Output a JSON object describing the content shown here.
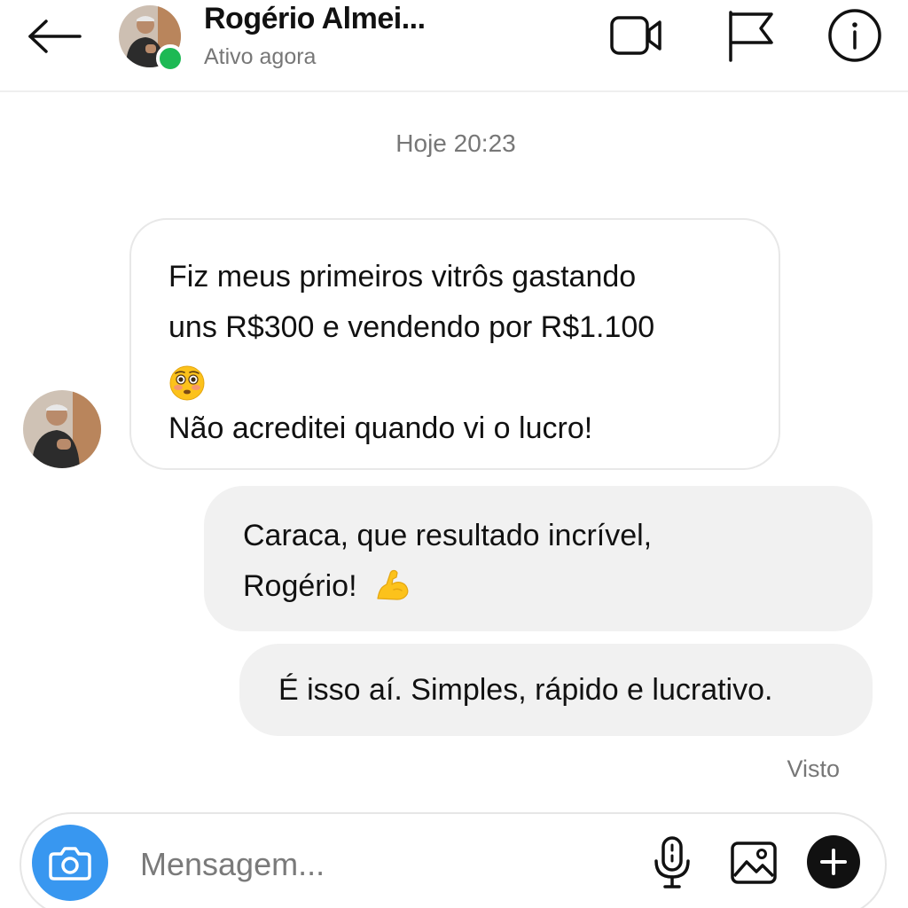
{
  "header": {
    "contact_name": "Rogério Almei...",
    "status": "Ativo agora",
    "icons": {
      "back": "arrow-left-icon",
      "video": "video-camera-icon",
      "report": "flag-icon",
      "info": "info-icon"
    },
    "online_color": "#1db954"
  },
  "chat": {
    "timestamp": "Hoje 20:23",
    "incoming": {
      "lines": [
        "Fiz meus primeiros vitrôs gastando",
        "uns R$300 e vendendo por R$1.100",
        "😳",
        "Não acreditei quando vi o lucro!"
      ]
    },
    "outgoing": [
      {
        "lines": [
          "Caraca, que resultado incrível,",
          "Rogério!"
        ],
        "emoji": "💪"
      },
      {
        "lines": [
          "É isso aí. Simples, rápido e lucrativo."
        ]
      }
    ],
    "seen_label": "Visto"
  },
  "composer": {
    "placeholder": "Mensagem...",
    "icons": {
      "camera": "camera-icon",
      "mic": "microphone-icon",
      "gallery": "image-icon",
      "add": "plus-icon"
    },
    "accent": "#3897f0"
  }
}
